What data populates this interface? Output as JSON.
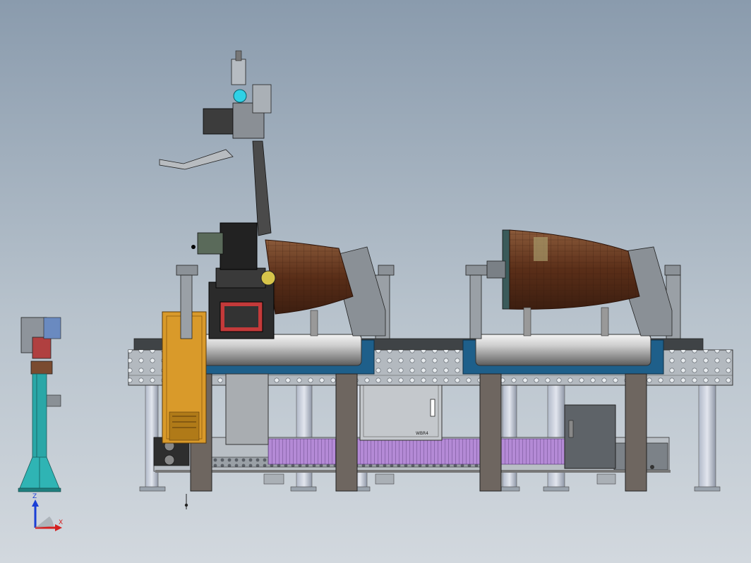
{
  "viewport": {
    "background_top": "#8a9bad",
    "background_bottom": "#d2d8de"
  },
  "triad": {
    "z_label": "Z",
    "x_label": "X",
    "z_color": "#1a3fd6",
    "x_color": "#d42020"
  },
  "cabinet": {
    "label": "WBR4"
  },
  "colors": {
    "steel": "#9aa3ad",
    "table_top": "#c5cad0",
    "table_dark": "#4a4e53",
    "beam_blue": "#1e5f8a",
    "pillar": "#6e6660",
    "bellows": "#a780c9",
    "duct_brown": "#6b3a22",
    "orange_cabinet": "#d99a2a",
    "teal_stand": "#2aa7a7",
    "robot_dark": "#2b2b2b"
  }
}
